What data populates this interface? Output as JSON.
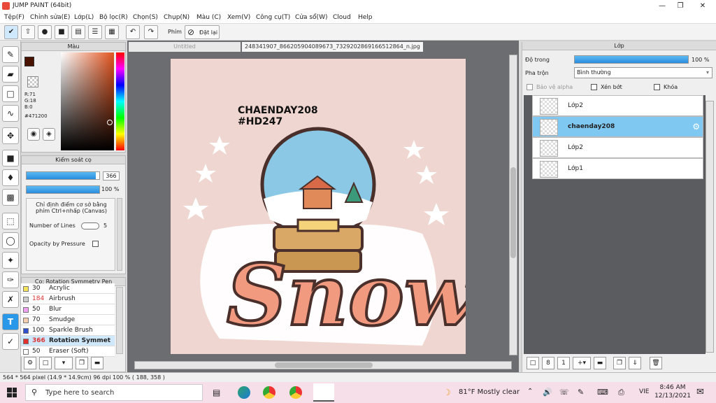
{
  "app": {
    "title": "JUMP PAINT (64bit)"
  },
  "menu": [
    "Tệp(F)",
    "Chỉnh sửa(E)",
    "Lớp(L)",
    "Bộ lọc(R)",
    "Chọn(S)",
    "Chụp(N)",
    "Màu (C)",
    "Xem(V)",
    "Công cụ(T)",
    "Cửa sổ(W)",
    "Cloud",
    "Help"
  ],
  "toolbar": {
    "phim": "Phím",
    "reset": "Đặt lại"
  },
  "color": {
    "title": "Màu",
    "r": "R:71",
    "g": "G:18",
    "b": "B:0",
    "hex": "#471200",
    "main": "#471200"
  },
  "brushctl": {
    "title": "Kiểm soát cọ",
    "size": "366",
    "opacity": "100 %",
    "size_fill": 0.95,
    "opacity_fill": 1.0,
    "hint": "Chỉ định điểm cơ sở bằng phím Ctrl+nhấp (Canvas)",
    "lines_label": "Number of Lines",
    "lines_val": "5",
    "pressure": "Opacity by Pressure"
  },
  "brushlist": {
    "title": "Cọ: Rotation Symmetry Pen",
    "items": [
      {
        "size": "30",
        "name": "Acrylic",
        "color": "#f5e35a"
      },
      {
        "size": "184",
        "name": "Airbrush",
        "color": "#cccccc"
      },
      {
        "size": "50",
        "name": "Blur",
        "color": "#f0a0f0"
      },
      {
        "size": "70",
        "name": "Smudge",
        "color": "#f5d0b0"
      },
      {
        "size": "100",
        "name": "Sparkle Brush",
        "color": "#3050d0"
      },
      {
        "size": "366",
        "name": "Rotation Symmet",
        "color": "#e03030"
      },
      {
        "size": "50",
        "name": "Eraser (Soft)",
        "color": "#ffffff"
      }
    ]
  },
  "tabs": {
    "untitled": "Untitled",
    "file": "248341907_866205904089673_7329202869166512864_n.jpg"
  },
  "artwork": {
    "line1": "CHAENDAY208",
    "line2": "#HD247",
    "word": "Snow"
  },
  "layers": {
    "title": "Lớp",
    "opacity_label": "Độ trong",
    "opacity_val": "100 %",
    "blend_label": "Pha trộn",
    "blend_val": "Bình thường",
    "protect_alpha": "Bảo vệ alpha",
    "clip": "Xén bớt",
    "lock": "Khóa",
    "items": [
      {
        "name": "Lớp2"
      },
      {
        "name": "chaenday208"
      },
      {
        "name": "Lớp2"
      },
      {
        "name": "Lớp1"
      }
    ]
  },
  "status": {
    "text": "564 * 564 pixel   (14.9 * 14.9cm)   96 dpi   100 %   ( 188, 358 )"
  },
  "taskbar": {
    "search": "Type here to search",
    "weather": "81°F  Mostly clear",
    "lang": "VIE",
    "time": "8:46 AM",
    "date": "12/13/2021"
  }
}
